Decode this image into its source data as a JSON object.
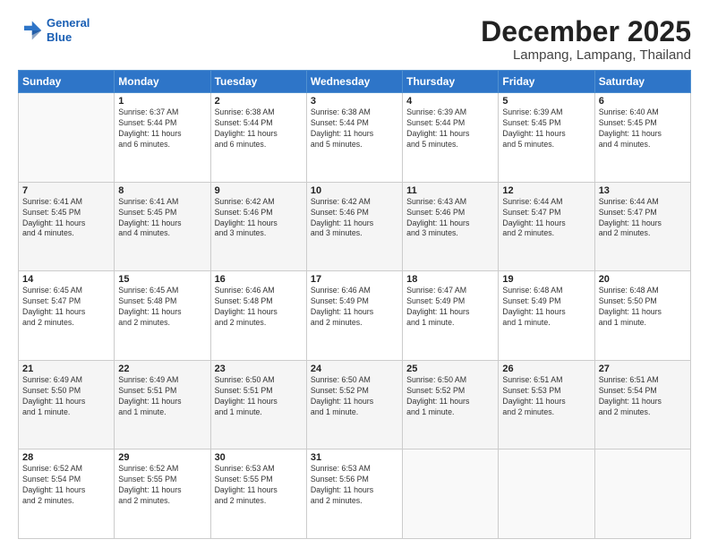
{
  "header": {
    "logo_line1": "General",
    "logo_line2": "Blue",
    "month": "December 2025",
    "location": "Lampang, Lampang, Thailand"
  },
  "weekdays": [
    "Sunday",
    "Monday",
    "Tuesday",
    "Wednesday",
    "Thursday",
    "Friday",
    "Saturday"
  ],
  "weeks": [
    [
      {
        "day": "",
        "info": ""
      },
      {
        "day": "1",
        "info": "Sunrise: 6:37 AM\nSunset: 5:44 PM\nDaylight: 11 hours\nand 6 minutes."
      },
      {
        "day": "2",
        "info": "Sunrise: 6:38 AM\nSunset: 5:44 PM\nDaylight: 11 hours\nand 6 minutes."
      },
      {
        "day": "3",
        "info": "Sunrise: 6:38 AM\nSunset: 5:44 PM\nDaylight: 11 hours\nand 5 minutes."
      },
      {
        "day": "4",
        "info": "Sunrise: 6:39 AM\nSunset: 5:44 PM\nDaylight: 11 hours\nand 5 minutes."
      },
      {
        "day": "5",
        "info": "Sunrise: 6:39 AM\nSunset: 5:45 PM\nDaylight: 11 hours\nand 5 minutes."
      },
      {
        "day": "6",
        "info": "Sunrise: 6:40 AM\nSunset: 5:45 PM\nDaylight: 11 hours\nand 4 minutes."
      }
    ],
    [
      {
        "day": "7",
        "info": "Sunrise: 6:41 AM\nSunset: 5:45 PM\nDaylight: 11 hours\nand 4 minutes."
      },
      {
        "day": "8",
        "info": "Sunrise: 6:41 AM\nSunset: 5:45 PM\nDaylight: 11 hours\nand 4 minutes."
      },
      {
        "day": "9",
        "info": "Sunrise: 6:42 AM\nSunset: 5:46 PM\nDaylight: 11 hours\nand 3 minutes."
      },
      {
        "day": "10",
        "info": "Sunrise: 6:42 AM\nSunset: 5:46 PM\nDaylight: 11 hours\nand 3 minutes."
      },
      {
        "day": "11",
        "info": "Sunrise: 6:43 AM\nSunset: 5:46 PM\nDaylight: 11 hours\nand 3 minutes."
      },
      {
        "day": "12",
        "info": "Sunrise: 6:44 AM\nSunset: 5:47 PM\nDaylight: 11 hours\nand 2 minutes."
      },
      {
        "day": "13",
        "info": "Sunrise: 6:44 AM\nSunset: 5:47 PM\nDaylight: 11 hours\nand 2 minutes."
      }
    ],
    [
      {
        "day": "14",
        "info": "Sunrise: 6:45 AM\nSunset: 5:47 PM\nDaylight: 11 hours\nand 2 minutes."
      },
      {
        "day": "15",
        "info": "Sunrise: 6:45 AM\nSunset: 5:48 PM\nDaylight: 11 hours\nand 2 minutes."
      },
      {
        "day": "16",
        "info": "Sunrise: 6:46 AM\nSunset: 5:48 PM\nDaylight: 11 hours\nand 2 minutes."
      },
      {
        "day": "17",
        "info": "Sunrise: 6:46 AM\nSunset: 5:49 PM\nDaylight: 11 hours\nand 2 minutes."
      },
      {
        "day": "18",
        "info": "Sunrise: 6:47 AM\nSunset: 5:49 PM\nDaylight: 11 hours\nand 1 minute."
      },
      {
        "day": "19",
        "info": "Sunrise: 6:48 AM\nSunset: 5:49 PM\nDaylight: 11 hours\nand 1 minute."
      },
      {
        "day": "20",
        "info": "Sunrise: 6:48 AM\nSunset: 5:50 PM\nDaylight: 11 hours\nand 1 minute."
      }
    ],
    [
      {
        "day": "21",
        "info": "Sunrise: 6:49 AM\nSunset: 5:50 PM\nDaylight: 11 hours\nand 1 minute."
      },
      {
        "day": "22",
        "info": "Sunrise: 6:49 AM\nSunset: 5:51 PM\nDaylight: 11 hours\nand 1 minute."
      },
      {
        "day": "23",
        "info": "Sunrise: 6:50 AM\nSunset: 5:51 PM\nDaylight: 11 hours\nand 1 minute."
      },
      {
        "day": "24",
        "info": "Sunrise: 6:50 AM\nSunset: 5:52 PM\nDaylight: 11 hours\nand 1 minute."
      },
      {
        "day": "25",
        "info": "Sunrise: 6:50 AM\nSunset: 5:52 PM\nDaylight: 11 hours\nand 1 minute."
      },
      {
        "day": "26",
        "info": "Sunrise: 6:51 AM\nSunset: 5:53 PM\nDaylight: 11 hours\nand 2 minutes."
      },
      {
        "day": "27",
        "info": "Sunrise: 6:51 AM\nSunset: 5:54 PM\nDaylight: 11 hours\nand 2 minutes."
      }
    ],
    [
      {
        "day": "28",
        "info": "Sunrise: 6:52 AM\nSunset: 5:54 PM\nDaylight: 11 hours\nand 2 minutes."
      },
      {
        "day": "29",
        "info": "Sunrise: 6:52 AM\nSunset: 5:55 PM\nDaylight: 11 hours\nand 2 minutes."
      },
      {
        "day": "30",
        "info": "Sunrise: 6:53 AM\nSunset: 5:55 PM\nDaylight: 11 hours\nand 2 minutes."
      },
      {
        "day": "31",
        "info": "Sunrise: 6:53 AM\nSunset: 5:56 PM\nDaylight: 11 hours\nand 2 minutes."
      },
      {
        "day": "",
        "info": ""
      },
      {
        "day": "",
        "info": ""
      },
      {
        "day": "",
        "info": ""
      }
    ]
  ]
}
